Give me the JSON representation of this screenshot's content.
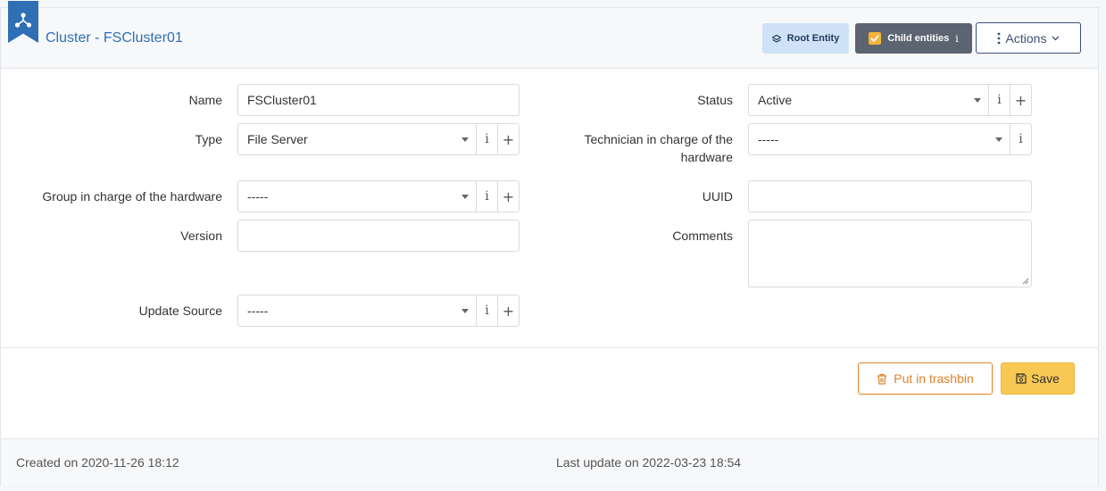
{
  "header": {
    "title": "Cluster - FSCluster01",
    "root_entity_label": "Root Entity",
    "child_entities_label": "Child entities",
    "child_entities_info": "i",
    "actions_label": "Actions"
  },
  "form": {
    "name_label": "Name",
    "name_value": "FSCluster01",
    "status_label": "Status",
    "status_value": "Active",
    "type_label": "Type",
    "type_value": "File Server",
    "technician_label": "Technician in charge of the hardware",
    "technician_value": "-----",
    "group_label": "Group in charge of the hardware",
    "group_value": "-----",
    "uuid_label": "UUID",
    "uuid_value": "",
    "version_label": "Version",
    "version_value": "",
    "comments_label": "Comments",
    "comments_value": "",
    "update_source_label": "Update Source",
    "update_source_value": "-----"
  },
  "buttons": {
    "trash_label": "Put in trashbin",
    "save_label": "Save",
    "info_glyph": "i",
    "plus_glyph": "+"
  },
  "footer": {
    "created": "Created on 2020-11-26 18:12",
    "updated": "Last update on 2022-03-23 18:54"
  }
}
